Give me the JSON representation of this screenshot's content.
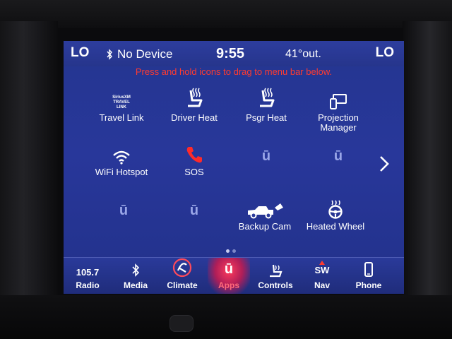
{
  "status": {
    "temp_left": "LO",
    "temp_right": "LO",
    "device": "No Device",
    "time": "9:55",
    "outside_temp": "41°out."
  },
  "hint": "Press and hold icons to drag to menu bar below.",
  "apps": {
    "travel_link": {
      "label": "Travel Link",
      "logo_text": "SiriusXM TRAVEL LINK"
    },
    "driver_heat": {
      "label": "Driver Heat"
    },
    "psgr_heat": {
      "label": "Psgr Heat"
    },
    "projection_manager": {
      "label": "Projection Manager"
    },
    "wifi_hotspot": {
      "label": "WiFi Hotspot"
    },
    "sos": {
      "label": "SOS"
    },
    "backup_cam": {
      "label": "Backup Cam"
    },
    "heated_wheel": {
      "label": "Heated Wheel"
    },
    "placeholder_glyph": "ū"
  },
  "pagination": {
    "pages": 2,
    "current": 1
  },
  "menu": {
    "radio_freq": "105.7",
    "radio": "Radio",
    "media": "Media",
    "climate": "Climate",
    "apps": "Apps",
    "apps_glyph": "ū",
    "controls": "Controls",
    "nav": "Nav",
    "nav_badge": "SW",
    "phone": "Phone"
  },
  "colors": {
    "screen_bg": "#28379a",
    "hint_red": "#ff3b30",
    "active_accent": "#ff3b5c"
  }
}
